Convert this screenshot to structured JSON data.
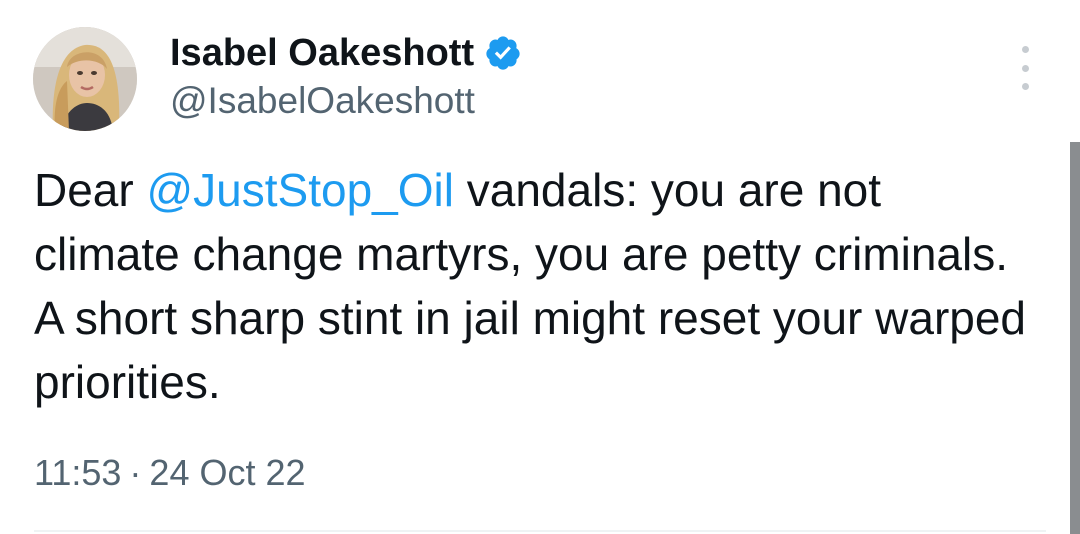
{
  "tweet": {
    "author": {
      "display_name": "Isabel Oakeshott",
      "handle": "@IsabelOakeshott",
      "verified": true,
      "verified_icon": "verified-badge-icon",
      "avatar_icon": "avatar-photo"
    },
    "text": {
      "before_mention": "Dear ",
      "mention": "@JustStop_Oil",
      "after_mention": " vandals: you are not climate change martyrs, you are petty criminals. A short sharp stint in jail might reset your warped priorities."
    },
    "time": "11:53",
    "separator": "·",
    "date": "24 Oct 22"
  },
  "colors": {
    "text": "#0f1419",
    "secondary": "#536471",
    "accent": "#1d9bf0",
    "divider": "#eff3f4"
  },
  "menu": {
    "more_icon": "more-vertical-icon"
  }
}
